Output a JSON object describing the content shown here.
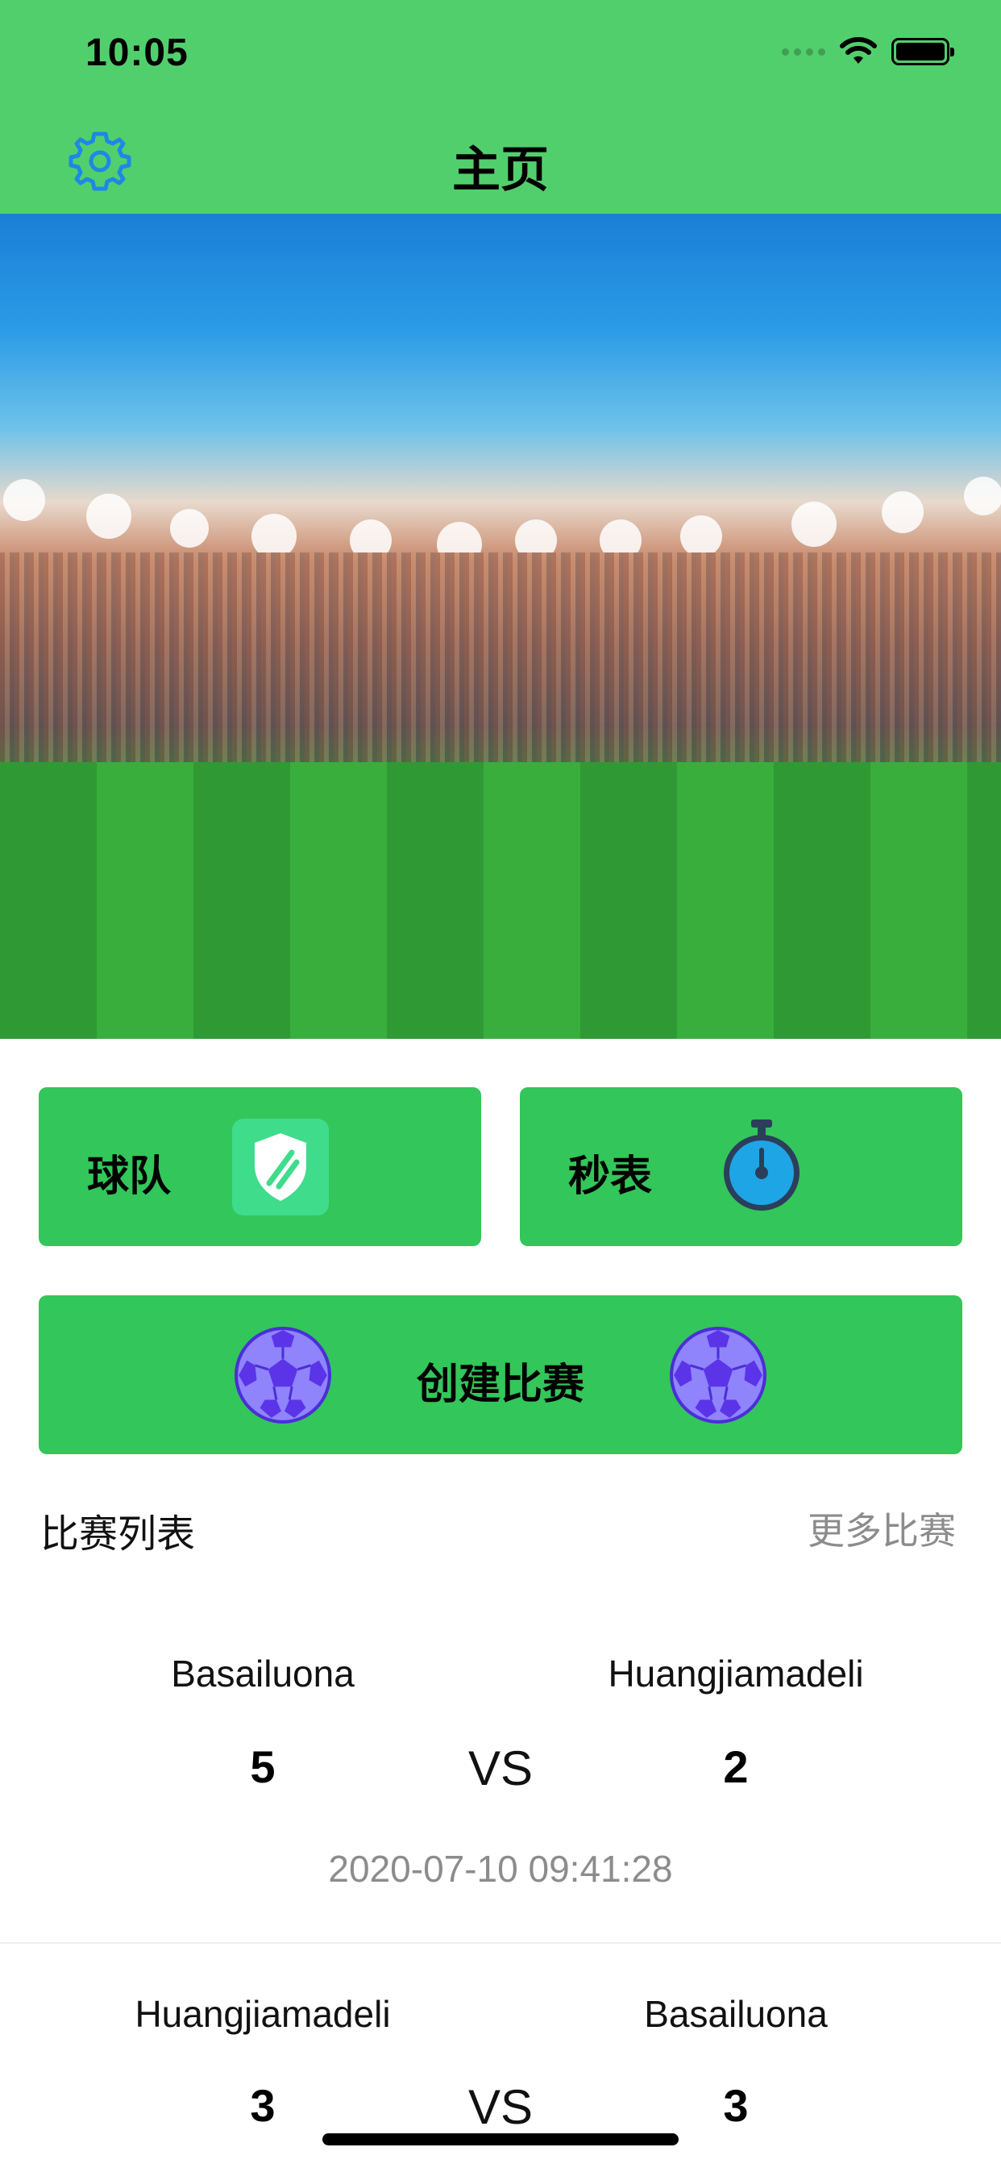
{
  "status_bar": {
    "time": "10:05"
  },
  "nav": {
    "title": "主页",
    "settings_icon": "gear-icon"
  },
  "hero": {
    "image": "football-stadium-photo"
  },
  "tiles": {
    "team": {
      "label": "球队",
      "icon": "shield-icon"
    },
    "stopwatch": {
      "label": "秒表",
      "icon": "stopwatch-icon"
    },
    "create_match": {
      "label": "创建比赛",
      "icon": "soccer-ball-icon"
    }
  },
  "match_list": {
    "title": "比赛列表",
    "more_label": "更多比赛",
    "matches": [
      {
        "home": "Basailuona",
        "away": "Huangjiamadeli",
        "home_score": "5",
        "away_score": "2",
        "vs": "VS",
        "date": "2020-07-10 09:41:28"
      },
      {
        "home": "Huangjiamadeli",
        "away": "Basailuona",
        "home_score": "3",
        "away_score": "3",
        "vs": "VS"
      }
    ]
  },
  "colors": {
    "header_green": "#52cf6d",
    "tile_green": "#33c65a",
    "settings_blue": "#1e88e5",
    "ball_purple": "#7b5cf5",
    "muted_text": "#8c8c8c"
  }
}
